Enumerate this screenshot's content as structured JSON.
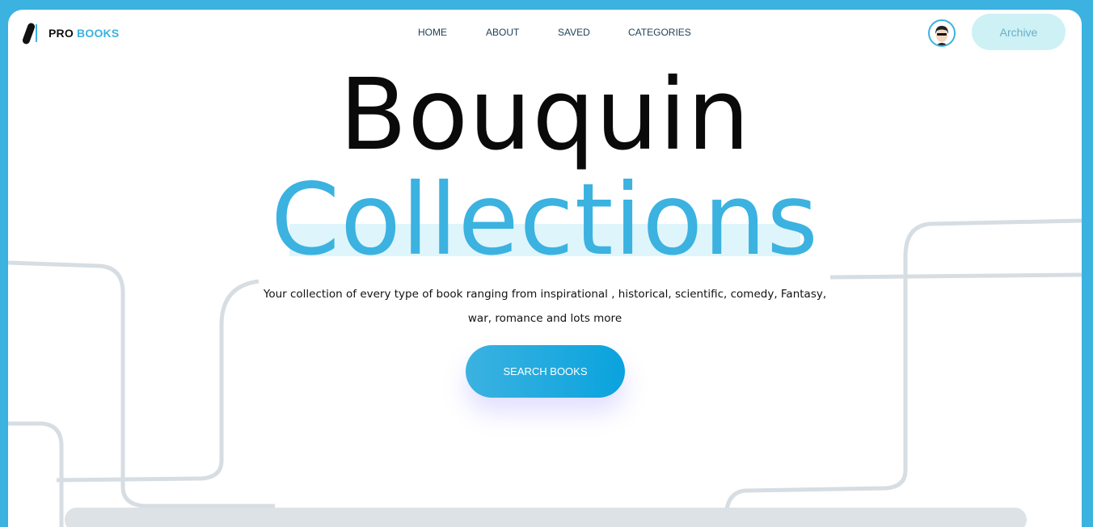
{
  "brand": {
    "part1": "PRO",
    "part2": "BOOKS"
  },
  "nav": {
    "items": [
      {
        "label": "HOME"
      },
      {
        "label": "ABOUT"
      },
      {
        "label": "SAVED"
      },
      {
        "label": "CATEGORIES"
      }
    ]
  },
  "header": {
    "archive_label": "Archive"
  },
  "hero": {
    "title_line1": "Bouquin",
    "title_line2": "Collections",
    "description": "Your collection of every type of book ranging from inspirational , historical, scientific, comedy, Fantasy, war, romance and lots more",
    "cta_label": "SEARCH BOOKS"
  },
  "colors": {
    "accent": "#3bb2e0",
    "archive_bg": "#cdf1f4",
    "highlight": "#def5fb",
    "decor_lines": "#d6dde3"
  }
}
